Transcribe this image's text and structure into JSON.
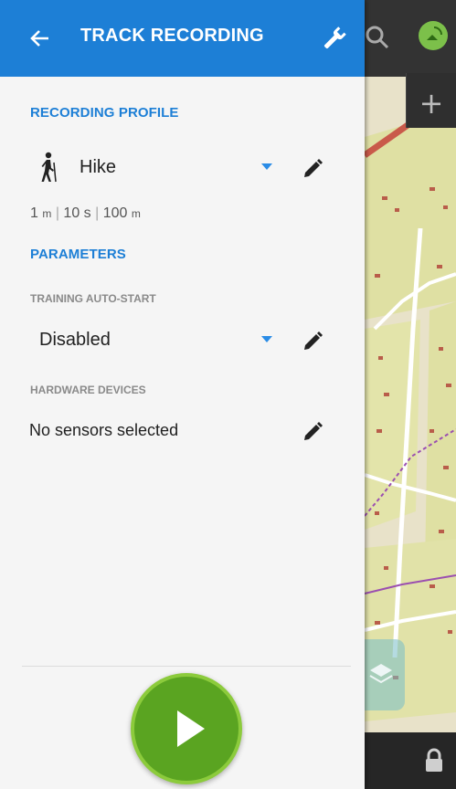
{
  "app_bar": {
    "title": "TRACK RECORDING"
  },
  "recording_profile": {
    "header": "RECORDING PROFILE",
    "selected": "Hike",
    "stats": {
      "distance_value": "1",
      "distance_unit": "m",
      "time_value": "10 s",
      "accuracy_value": "100",
      "accuracy_unit": "m",
      "separator": "|"
    }
  },
  "parameters": {
    "header": "PARAMETERS",
    "training_autostart": {
      "label": "TRAINING AUTO-START",
      "value": "Disabled"
    },
    "hardware_devices": {
      "label": "HARDWARE DEVICES",
      "value": "No sensors selected"
    }
  },
  "icons": {
    "back": "arrow-left-icon",
    "settings": "wrench-icon",
    "profile": "hiker-icon",
    "edit": "pencil-icon",
    "dropdown": "caret-down-icon",
    "start": "play-icon",
    "map_search": "search-icon",
    "map_gps": "gps-satellite-icon",
    "map_zoom": "plus-icon",
    "map_layers": "layers-icon",
    "map_lock": "lock-icon"
  },
  "colors": {
    "app_bar": "#1d7fd6",
    "accent": "#1d7fd6",
    "dropdown_caret": "#2a8ce6",
    "start_button": "#5aa421",
    "start_ring": "#8ccb3c"
  }
}
